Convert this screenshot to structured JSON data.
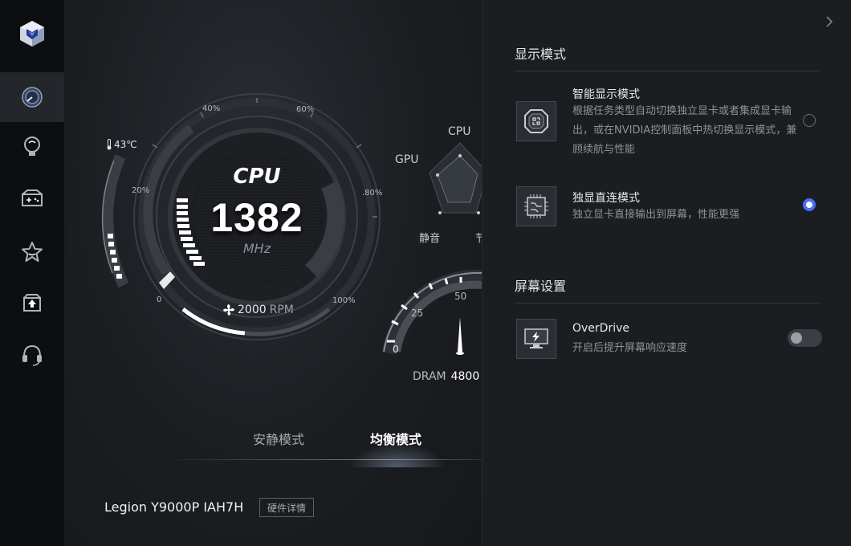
{
  "sidebar": {
    "items": [
      {
        "name": "performance",
        "icon": "gauge-icon"
      },
      {
        "name": "lighting",
        "icon": "bulb-icon"
      },
      {
        "name": "game",
        "icon": "gamepad-icon"
      },
      {
        "name": "favorites",
        "icon": "star-icon"
      },
      {
        "name": "update",
        "icon": "upload-icon"
      },
      {
        "name": "support",
        "icon": "headset-icon"
      }
    ],
    "active_index": 0
  },
  "gauge": {
    "title": "CPU",
    "frequency": "1382",
    "unit": "MHz",
    "temperature": "43℃",
    "fan_speed": "2000",
    "fan_unit": "RPM",
    "ticks": [
      "0",
      "20%",
      "40%",
      "60%",
      ".80%",
      "100%"
    ]
  },
  "radar": {
    "cpu_label": "CPU",
    "gpu_label": "GPU",
    "quiet_label": "静音",
    "partial_label": "节"
  },
  "dram_gauge": {
    "label": "DRAM",
    "value": "4800",
    "ticks": [
      "0",
      "25",
      "50"
    ]
  },
  "modes": {
    "tabs": [
      "安静模式",
      "均衡模式"
    ],
    "active_index": 1
  },
  "device": {
    "model": "Legion Y9000P IAH7H",
    "details_button": "硬件详情"
  },
  "panel": {
    "display_mode": {
      "title": "显示模式",
      "options": [
        {
          "title": "智能显示模式",
          "desc": "根据任务类型自动切换独立显卡或者集成显卡输出，或在NVIDIA控制面板中热切换显示模式，兼顾续航与性能",
          "selected": false
        },
        {
          "title": "独显直连模式",
          "desc": "独立显卡直接输出到屏幕，性能更强",
          "selected": true
        }
      ]
    },
    "screen_settings": {
      "title": "屏幕设置",
      "overdrive": {
        "title": "OverDrive",
        "desc": "开启后提升屏幕响应速度",
        "enabled": false
      }
    }
  },
  "colors": {
    "accent": "#4a6cf7",
    "background": "#16181c",
    "panel": "#1b1d21"
  }
}
